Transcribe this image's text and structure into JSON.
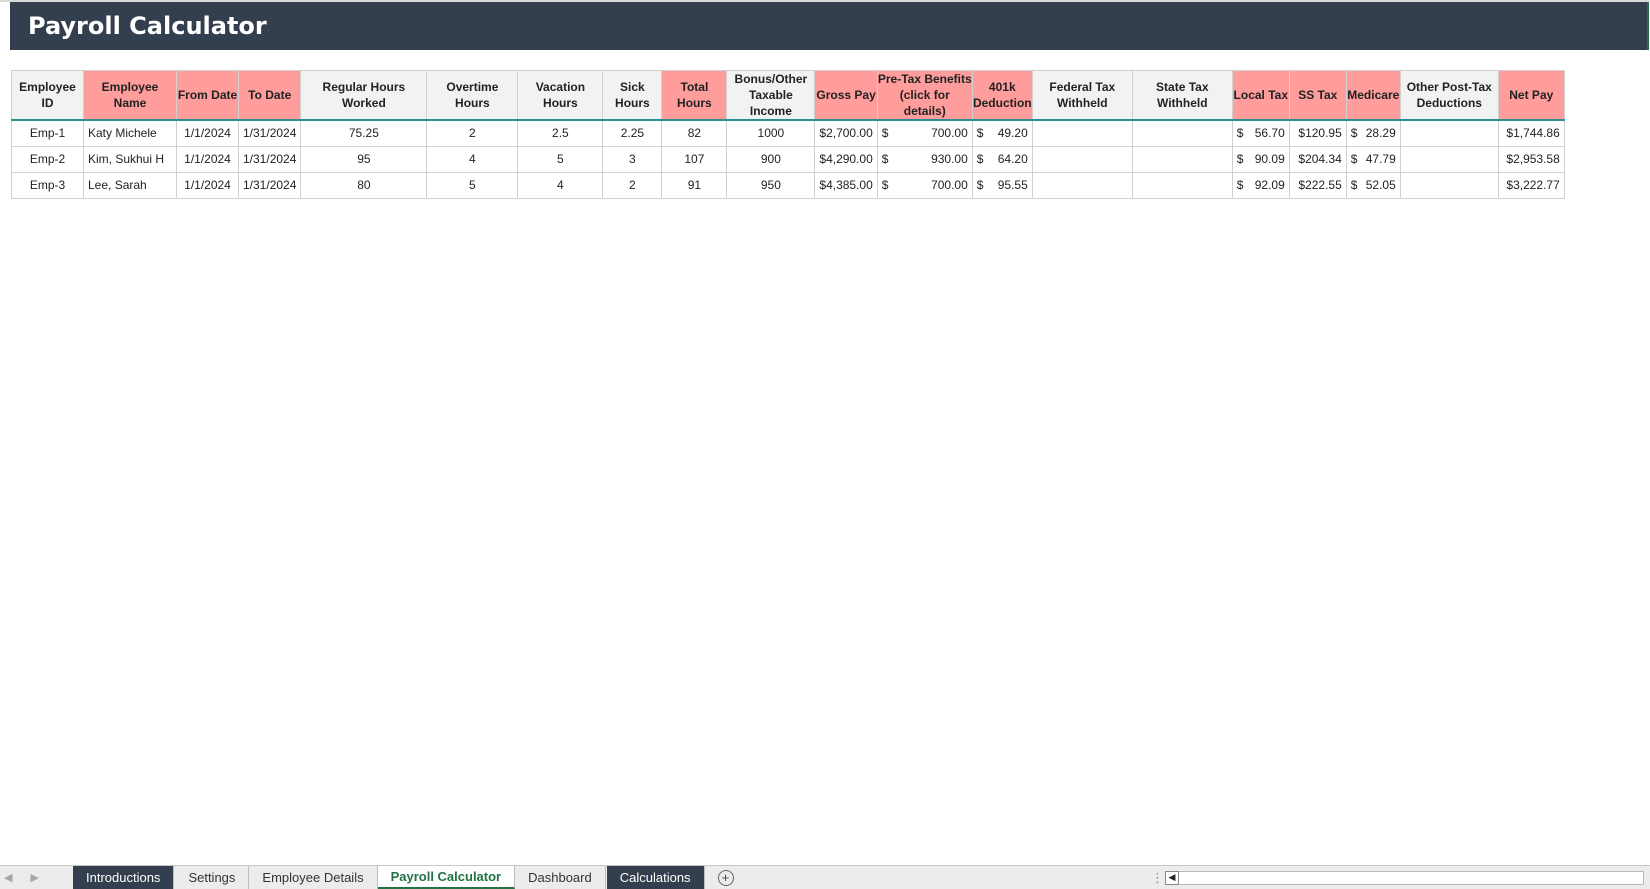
{
  "title": "Payroll Calculator",
  "columns": [
    {
      "label": "Employee ID",
      "highlight": false
    },
    {
      "label": "Employee Name",
      "highlight": true
    },
    {
      "label": "From Date",
      "highlight": true
    },
    {
      "label": "To Date",
      "highlight": true
    },
    {
      "label": "Regular Hours Worked",
      "highlight": false
    },
    {
      "label": "Overtime Hours",
      "highlight": false
    },
    {
      "label": "Vacation Hours",
      "highlight": false
    },
    {
      "label": "Sick Hours",
      "highlight": false
    },
    {
      "label": "Total Hours",
      "highlight": true
    },
    {
      "label": "Bonus/Other Taxable Income",
      "highlight": false
    },
    {
      "label": "Gross Pay",
      "highlight": true
    },
    {
      "label": "Pre-Tax Benefits (click for details)",
      "highlight": true
    },
    {
      "label": "401k Deduction",
      "highlight": true
    },
    {
      "label": "Federal Tax Withheld",
      "highlight": false
    },
    {
      "label": "State Tax Withheld",
      "highlight": false
    },
    {
      "label": "Local Tax",
      "highlight": true
    },
    {
      "label": "SS Tax",
      "highlight": true
    },
    {
      "label": "Medicare",
      "highlight": true
    },
    {
      "label": "Other Post-Tax Deductions",
      "highlight": false
    },
    {
      "label": "Net Pay",
      "highlight": true
    }
  ],
  "rows": [
    [
      "Emp-1",
      "Katy Michele",
      "1/1/2024",
      "1/31/2024",
      "75.25",
      "2",
      "2.5",
      "2.25",
      "82",
      "1000",
      "$2,700.00",
      "700.00",
      "49.20",
      "",
      "",
      "56.70",
      "$120.95",
      "28.29",
      "",
      "$1,744.86"
    ],
    [
      "Emp-2",
      "Kim, Sukhui H",
      "1/1/2024",
      "1/31/2024",
      "95",
      "4",
      "5",
      "3",
      "107",
      "900",
      "$4,290.00",
      "930.00",
      "64.20",
      "",
      "",
      "90.09",
      "$204.34",
      "47.79",
      "",
      "$2,953.58"
    ],
    [
      "Emp-3",
      "Lee, Sarah",
      "1/1/2024",
      "1/31/2024",
      "80",
      "5",
      "4",
      "2",
      "91",
      "950",
      "$4,385.00",
      "700.00",
      "95.55",
      "",
      "",
      "92.09",
      "$222.55",
      "52.05",
      "",
      "$3,222.77"
    ]
  ],
  "currency_symbol": "$",
  "sheet_tabs": [
    {
      "label": "Introductions",
      "style": "dark"
    },
    {
      "label": "Settings",
      "style": "normal"
    },
    {
      "label": "Employee Details",
      "style": "normal"
    },
    {
      "label": "Payroll Calculator",
      "style": "active"
    },
    {
      "label": "Dashboard",
      "style": "normal"
    },
    {
      "label": "Calculations",
      "style": "dark"
    }
  ],
  "icons": {
    "add_sheet": "+",
    "prev": "◀",
    "next": "▶",
    "more": "⋮"
  },
  "colors": {
    "title_bg": "#333f4f",
    "header_highlight": "#ff9c9c",
    "header_rule": "#2f8f8f",
    "active_tab": "#217346"
  }
}
